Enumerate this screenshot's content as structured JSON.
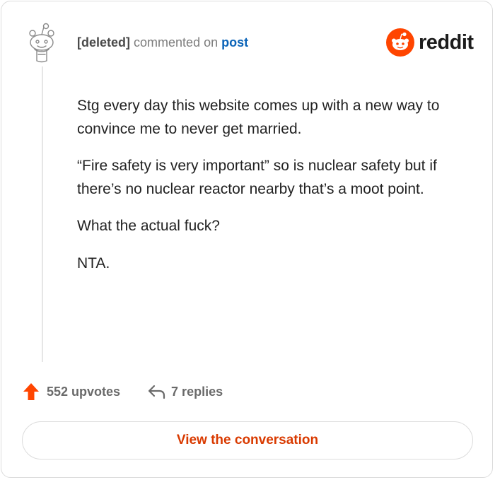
{
  "header": {
    "username": "[deleted]",
    "verb": "commented on",
    "link": "post"
  },
  "logo": {
    "text": "reddit"
  },
  "comment": {
    "paragraphs": [
      "Stg every day this website comes up with a new way to convince me to never get married.",
      "“Fire safety is very important” so is nuclear safety but if there’s no nuclear reactor nearby that’s a moot point.",
      "What the actual fuck?",
      "NTA."
    ]
  },
  "actions": {
    "upvotes": "552 upvotes",
    "replies": "7 replies"
  },
  "cta": {
    "label": "View the conversation"
  },
  "colors": {
    "brand_orange": "#ff4500",
    "upvote": "#ff4500",
    "link_blue": "#0a63b8",
    "cta_text": "#d93a00"
  },
  "icons": {
    "avatar": "snoo-avatar-icon",
    "logo": "reddit-logo-icon",
    "upvote": "upvote-arrow-icon",
    "reply": "reply-arrow-icon"
  }
}
